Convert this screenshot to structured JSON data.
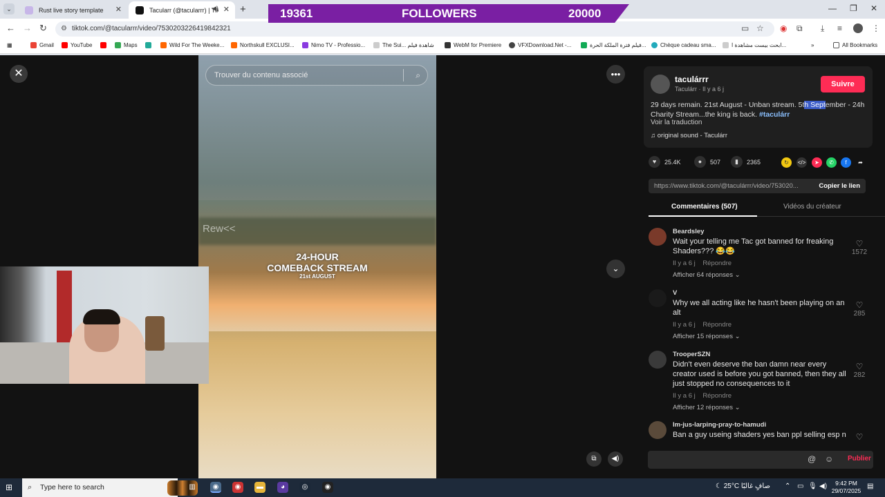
{
  "browser": {
    "tabs": [
      {
        "title": "Rust live story template"
      },
      {
        "title": "Tacularr (@tacularrr) | TikTo"
      }
    ],
    "new_tab_symbol": "+",
    "url": "tiktok.com/@tacularrr/video/7530203226419842321",
    "bookmarks": [
      "Gmail",
      "YouTube",
      "Maps",
      "Wild For The Weeke...",
      "Northskull EXCLUSI...",
      "Nimo TV - Professio...",
      "The Sui...",
      "شاهدة فيلم",
      "WebM for Premiere",
      "VFXDownload.Net -...",
      "فيلم فترة الملكة الحرة...",
      "Chèque cadeau sma...",
      "ابحث بيست مشاهدة ا...",
      "All Bookmarks"
    ]
  },
  "overlay_banner": {
    "left": "19361",
    "center": "FOLLOWERS",
    "right": "20000"
  },
  "video": {
    "search_placeholder": "Trouver du contenu associé",
    "rew_text": "Rew<<",
    "title_line1": "24-HOUR",
    "title_line2": "COMEBACK STREAM",
    "title_line3": "21st AUGUST"
  },
  "post": {
    "author_handle": "taculárrr",
    "author_name": "Taculárr",
    "age": "Il y a 6 j",
    "follow_label": "Suivre",
    "description_a": "29 days remain. 21st August - Unban stream. 5t",
    "description_hl": "h Sept",
    "description_b": "ember - 24h Charity Stream...the king is back. ",
    "hashtag": "#taculárr",
    "translate_label": "Voir la traduction",
    "sound": "original sound - Taculárr",
    "likes": "25.4K",
    "comments": "507",
    "saves": "2365",
    "link": "https://www.tiktok.com/@taculárrr/video/753020...",
    "copy_label": "Copier le lien"
  },
  "tabs": {
    "comments": "Commentaires (507)",
    "creator_videos": "Vidéos du créateur"
  },
  "comments": [
    {
      "name": "Beardsley",
      "text": "Wait your telling me Tac got banned for freaking Shaders??? 😂😂",
      "age": "Il y a 6 j",
      "reply": "Répondre",
      "more": "Afficher 64 réponses",
      "likes": "1572"
    },
    {
      "name": "V",
      "text": "Why we all acting like he hasn't been playing on an alt",
      "age": "Il y a 6 j",
      "reply": "Répondre",
      "more": "Afficher 15 réponses",
      "likes": "285"
    },
    {
      "name": "TrooperSZN",
      "text": "Didn't even deserve the ban damn near every creator used is before you got banned, then they all just stopped no consequences to it",
      "age": "Il y a 6 j",
      "reply": "Répondre",
      "more": "Afficher 12 réponses",
      "likes": "282"
    },
    {
      "name": "Im-jus-larping-pray-to-hamudi",
      "text": "Ban a guy useing shaders yes ban ppl selling esp n",
      "age": "",
      "reply": "",
      "more": "",
      "likes": ""
    }
  ],
  "composer": {
    "publish_label": "Publier"
  },
  "taskbar": {
    "search_placeholder": "Type here to search",
    "weather": "25°C",
    "weather_text": "صافٍ غالبًا",
    "time": "9:42 PM",
    "date": "29/07/2025"
  },
  "colors": {
    "accent": "#fe2c55",
    "banner": "#7a1fa3",
    "highlight": "#3b5cc8"
  }
}
